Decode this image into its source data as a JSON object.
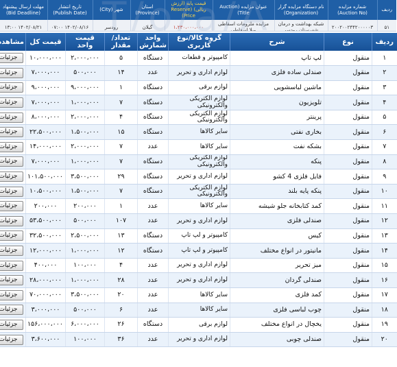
{
  "top_strip": {
    "headers": [
      {
        "id": "row",
        "text": "ردیف"
      },
      {
        "id": "auction_no",
        "text": "شماره مزایده (Auction No)"
      },
      {
        "id": "org",
        "text": "نام دستگاه مزایده گزار (Organization)"
      },
      {
        "id": "title",
        "text": "عنوان مزایده (Auction Title)"
      },
      {
        "id": "reserve",
        "text": "قیمت پایه (ارزش ریالی) (Reserve Price)"
      },
      {
        "id": "province",
        "text": "استان (Province)"
      },
      {
        "id": "city",
        "text": "شهر (City)"
      },
      {
        "id": "publish",
        "text": "تاریخ انتشار (Publish Date)"
      },
      {
        "id": "deadline",
        "text": "مهلت ارسال پیشنهاد (Bid Deadline)"
      }
    ],
    "row": {
      "row": "۵۱",
      "auction_no": "۲۰۰۲۰۰۲۴۴۲۰۰۰۰۰۳",
      "org": "شبکه بهداشت و درمان شهرستان رودسر",
      "title": "مزایده ملزومات اسقاطی ویلا اسقاطی",
      "reserve": "۱،۲۳۰،۰۰۰،۰۰۰",
      "province": "گیلان",
      "city": "رودسر",
      "publish": "۱۴۰۲/۰۸/۱۶ ۰۷:۰۰",
      "deadline": "۱۴۰۲/۰۸/۲۱ ۱۳:۰۰"
    },
    "watermark": "T/o/a/A"
  },
  "table": {
    "headers": {
      "idx": "ردیف",
      "type": "نوع",
      "desc": "شرح",
      "group": "گروه کالا/نوع کاربری",
      "unit": "واحد شمارش",
      "qty": "تعداد/مقدار",
      "price": "قیمت واحد",
      "total": "قیمت کل",
      "action": "مشاهده"
    },
    "button_label": "جزئیات",
    "rows": [
      {
        "idx": "۱",
        "type": "منقول",
        "desc": "لپ تاپ",
        "group": "کامپیوتر و قطعات",
        "unit": "دستگاه",
        "qty": "۵",
        "price": "۲،۰۰۰،۰۰۰",
        "total": "۱۰،۰۰۰،۰۰۰"
      },
      {
        "idx": "۲",
        "type": "منقول",
        "desc": "صندلی ساده فلزی",
        "group": "لوازم اداری و تحریر",
        "unit": "عدد",
        "qty": "۱۴",
        "price": "۵۰۰،۰۰۰",
        "total": "۷،۰۰۰،۰۰۰"
      },
      {
        "idx": "۳",
        "type": "منقول",
        "desc": "ماشین لباسشویی",
        "group": "لوازم برقی",
        "unit": "دستگاه",
        "qty": "۱",
        "price": "۹،۰۰۰،۰۰۰",
        "total": "۹،۰۰۰،۰۰۰"
      },
      {
        "idx": "۴",
        "type": "منقول",
        "desc": "تلویزیون",
        "group": "لوازم الکتریکی والکترونیکی",
        "unit": "دستگاه",
        "qty": "۷",
        "price": "۱،۰۰۰،۰۰۰",
        "total": "۷،۰۰۰،۰۰۰"
      },
      {
        "idx": "۵",
        "type": "منقول",
        "desc": "پرینتر",
        "group": "لوازم الکتریکی والکترونیکی",
        "unit": "دستگاه",
        "qty": "۴",
        "price": "۲،۰۰۰،۰۰۰",
        "total": "۸،۰۰۰،۰۰۰"
      },
      {
        "idx": "۶",
        "type": "منقول",
        "desc": "بخاری نفتی",
        "group": "سایر کالاها",
        "unit": "دستگاه",
        "qty": "۱۵",
        "price": "۱،۵۰۰،۰۰۰",
        "total": "۲۲،۵۰۰،۰۰۰"
      },
      {
        "idx": "۷",
        "type": "منقول",
        "desc": "بشکه نفت",
        "group": "سایر کالاها",
        "unit": "عدد",
        "qty": "۷",
        "price": "۲،۰۰۰،۰۰۰",
        "total": "۱۴،۰۰۰،۰۰۰"
      },
      {
        "idx": "۸",
        "type": "منقول",
        "desc": "پنکه",
        "group": "لوازم الکتریکی والکترونیکی",
        "unit": "دستگاه",
        "qty": "۷",
        "price": "۱،۰۰۰،۰۰۰",
        "total": "۷،۰۰۰،۰۰۰"
      },
      {
        "idx": "۹",
        "type": "منقول",
        "desc": "فایل فلزی 4 کشو",
        "group": "لوازم اداری و تحریر",
        "unit": "دستگاه",
        "qty": "۲۹",
        "price": "۳،۵۰۰،۰۰۰",
        "total": "۱۰۱،۵۰۰،۰۰۰"
      },
      {
        "idx": "۱۰",
        "type": "منقول",
        "desc": "پنکه پایه بلند",
        "group": "لوازم الکتریکی والکترونیکی",
        "unit": "دستگاه",
        "qty": "۷",
        "price": "۱،۵۰۰،۰۰۰",
        "total": "۱۰،۵۰۰،۰۰۰"
      },
      {
        "idx": "۱۱",
        "type": "منقول",
        "desc": "کمد کتابخانه جلو شیشه",
        "group": "سایر کالاها",
        "unit": "عدد",
        "qty": "۱",
        "price": "۲۰۰،۰۰۰",
        "total": "۲۰۰،۰۰۰"
      },
      {
        "idx": "۱۲",
        "type": "منقول",
        "desc": "صندلی فلزی",
        "group": "لوازم اداری و تحریر",
        "unit": "عدد",
        "qty": "۱۰۷",
        "price": "۵۰۰،۰۰۰",
        "total": "۵۳،۵۰۰،۰۰۰"
      },
      {
        "idx": "۱۳",
        "type": "منقول",
        "desc": "کیس",
        "group": "کامپیوتر و لپ تاپ",
        "unit": "دستگاه",
        "qty": "۱۳",
        "price": "۲،۵۰۰،۰۰۰",
        "total": "۳۲،۵۰۰،۰۰۰"
      },
      {
        "idx": "۱۴",
        "type": "منقول",
        "desc": "مانیتور در انواع مختلف",
        "group": "کامپیوتر و لپ تاپ",
        "unit": "دستگاه",
        "qty": "۱۲",
        "price": "۱،۰۰۰،۰۰۰",
        "total": "۱۲،۰۰۰،۰۰۰"
      },
      {
        "idx": "۱۵",
        "type": "منقول",
        "desc": "میز تحریر",
        "group": "لوازم اداری و تحریر",
        "unit": "عدد",
        "qty": "۴",
        "price": "۱۰۰،۰۰۰",
        "total": "۴۰۰،۰۰۰"
      },
      {
        "idx": "۱۶",
        "type": "منقول",
        "desc": "صندلی گردان",
        "group": "لوازم اداری و تحریر",
        "unit": "عدد",
        "qty": "۲۸",
        "price": "۱،۰۰۰،۰۰۰",
        "total": "۲۸،۰۰۰،۰۰۰"
      },
      {
        "idx": "۱۷",
        "type": "منقول",
        "desc": "کمد فلزی",
        "group": "سایر کالاها",
        "unit": "عدد",
        "qty": "۲۰",
        "price": "۳،۵۰۰،۰۰۰",
        "total": "۷۰،۰۰۰،۰۰۰"
      },
      {
        "idx": "۱۸",
        "type": "منقول",
        "desc": "چوب لباسی فلزی",
        "group": "سایر کالاها",
        "unit": "عدد",
        "qty": "۶",
        "price": "۵۰۰،۰۰۰",
        "total": "۳،۰۰۰،۰۰۰"
      },
      {
        "idx": "۱۹",
        "type": "منقول",
        "desc": "یخچال در انواع مختلف",
        "group": "لوازم برقی",
        "unit": "دستگاه",
        "qty": "۲۶",
        "price": "۶،۰۰۰،۰۰۰",
        "total": "۱۵۶،۰۰۰،۰۰۰"
      },
      {
        "idx": "۲۰",
        "type": "منقول",
        "desc": "صندلی چوبی",
        "group": "لوازم اداری و تحریر",
        "unit": "عدد",
        "qty": "۳۶",
        "price": "۱۰۰،۰۰۰",
        "total": "۳،۶۰۰،۰۰۰"
      }
    ]
  },
  "colors": {
    "header_blue": "#1f5fa6",
    "row_alt": "#eaf2fb",
    "summary_bg": "#eef1f6"
  }
}
